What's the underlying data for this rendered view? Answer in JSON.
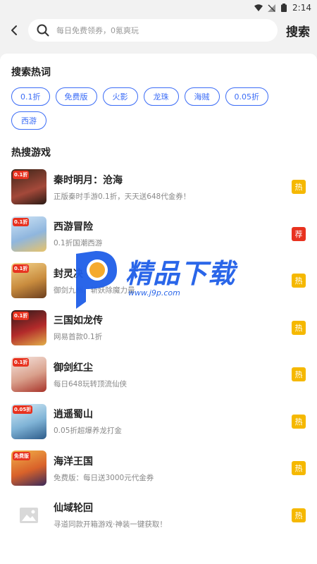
{
  "status": {
    "time": "2:14"
  },
  "search": {
    "placeholder": "每日免费领券，0氪爽玩",
    "button_label": "搜索"
  },
  "hot_words": {
    "title": "搜索热词",
    "tags": [
      "0.1折",
      "免费版",
      "火影",
      "龙珠",
      "海贼",
      "0.05折",
      "西游"
    ]
  },
  "hot_games": {
    "title": "热搜游戏",
    "items": [
      {
        "name": "秦时明月：沧海",
        "desc": "正版秦时手游0.1折，天天送648代金券！",
        "flag": "热",
        "badge": "0.1折"
      },
      {
        "name": "西游冒险",
        "desc": "0.1折国潮西游",
        "flag": "荐",
        "badge": "0.1折"
      },
      {
        "name": "封灵决",
        "desc": "御剑九州，斩妖除魔力量",
        "flag": "热",
        "badge": "0.1折"
      },
      {
        "name": "三国如龙传",
        "desc": "网易首款0.1折",
        "flag": "热",
        "badge": "0.1折"
      },
      {
        "name": "御剑红尘",
        "desc": "每日648玩转顶流仙侠",
        "flag": "热",
        "badge": "0.1折"
      },
      {
        "name": "逍遥蜀山",
        "desc": "0.05折超爆养龙打金",
        "flag": "热",
        "badge": "0.05折"
      },
      {
        "name": "海洋王国",
        "desc": "免费版：每日送3000元代金券",
        "flag": "热",
        "badge": "免费版"
      },
      {
        "name": "仙域轮回",
        "desc": "寻道同款开箱游戏·神装一键获取！",
        "flag": "热",
        "badge": ""
      }
    ]
  },
  "watermark": {
    "brand": "精品下载",
    "url": "www.j9p.com"
  },
  "colors": {
    "accent": "#3b6cf6",
    "flag_hot": "#f5b800",
    "flag_rec": "#e8321f"
  }
}
